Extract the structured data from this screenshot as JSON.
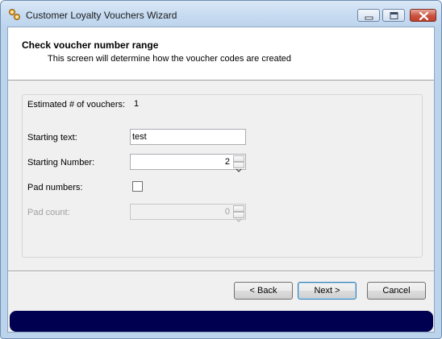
{
  "window": {
    "title": "Customer Loyalty Vouchers Wizard",
    "icon": "gear-icon",
    "controls": [
      "minimize-icon",
      "maximize-icon",
      "close-icon"
    ]
  },
  "header": {
    "title": "Check voucher number range",
    "subtitle": "This screen will determine how the voucher codes are created"
  },
  "form": {
    "estimated_label": "Estimated # of vouchers:",
    "estimated_value": "1",
    "starting_text_label": "Starting text:",
    "starting_text_value": "test",
    "starting_number_label": "Starting Number:",
    "starting_number_value": "2",
    "pad_numbers_label": "Pad numbers:",
    "pad_numbers_checked": false,
    "pad_count_label": "Pad count:",
    "pad_count_value": "0"
  },
  "buttons": {
    "back": "< Back",
    "next": "Next >",
    "cancel": "Cancel"
  },
  "colors": {
    "progress_bar": "#000050",
    "title_bar": "#c6dbf1"
  }
}
